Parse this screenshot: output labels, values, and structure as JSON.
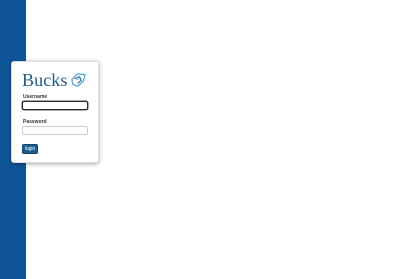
{
  "brand": {
    "logo_text": "Bucks",
    "logo_mark_icon": "bucks-emblem-icon",
    "logo_color": "#1f5a86",
    "side_band_color": "#0f5597"
  },
  "login": {
    "username_label": "Username",
    "username_value": "",
    "username_placeholder": "",
    "password_label": "Password",
    "password_value": "",
    "password_placeholder": "",
    "submit_label": "login",
    "button_color": "#1b5d8f"
  }
}
